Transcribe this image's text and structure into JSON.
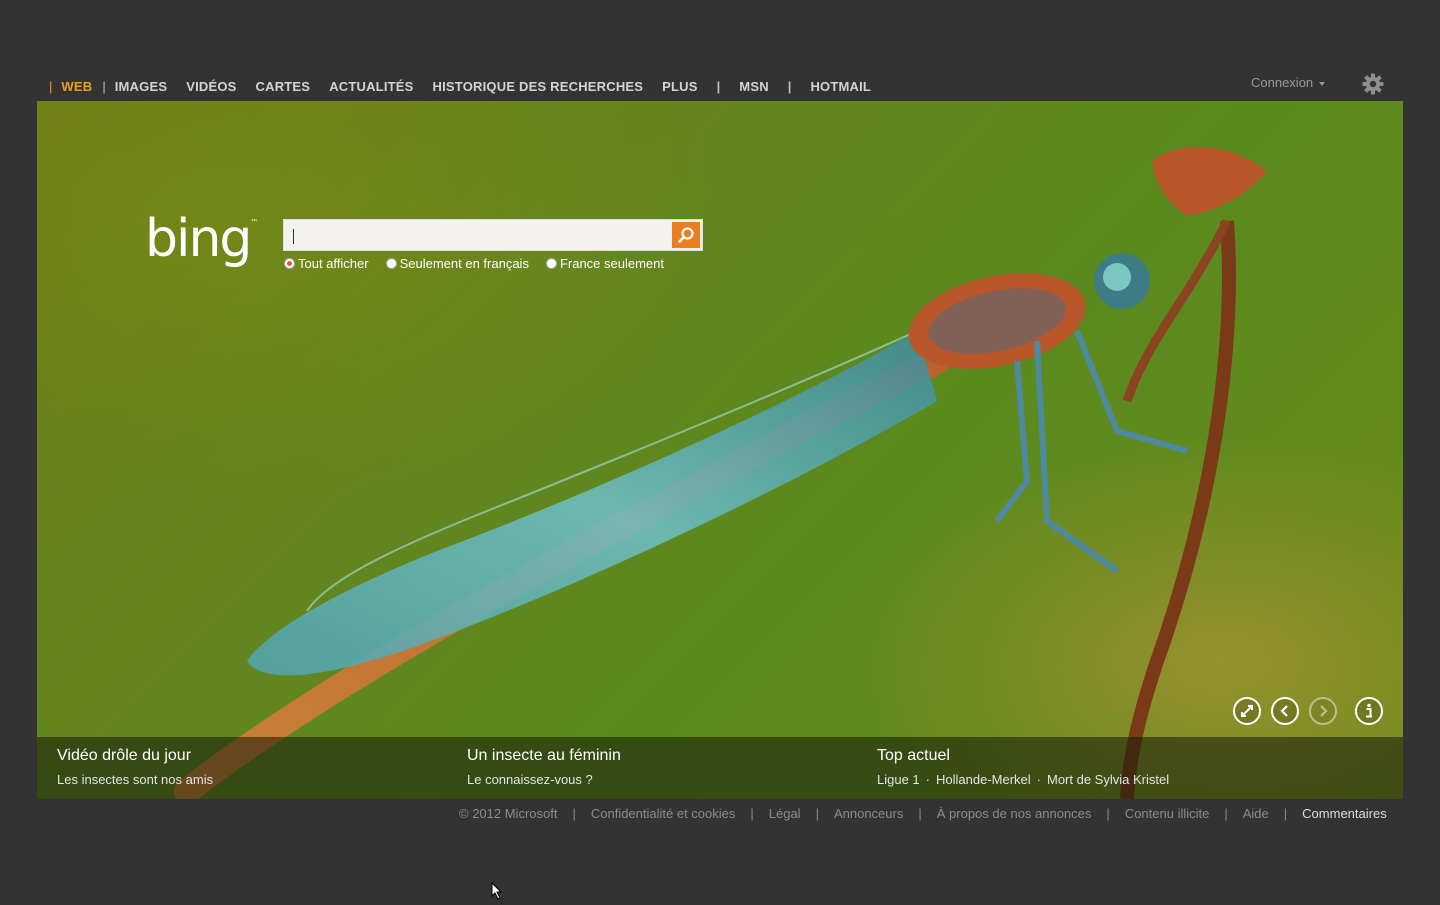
{
  "nav": {
    "items": [
      "WEB",
      "IMAGES",
      "VIDÉOS",
      "CARTES",
      "ACTUALITÉS",
      "HISTORIQUE DES RECHERCHES",
      "PLUS"
    ],
    "extra": [
      "MSN",
      "HOTMAIL"
    ],
    "active": "WEB",
    "active_color": "#f39c12"
  },
  "connexion": "Connexion",
  "logo": {
    "text": "bing",
    "tm": "™"
  },
  "search": {
    "value": "",
    "button_icon": "search-icon",
    "button_color": "#ea7f20",
    "options": [
      "Tout afficher",
      "Seulement en français",
      "France seulement"
    ],
    "selected": "Tout afficher"
  },
  "hero_controls": [
    "expand-icon",
    "previous-icon",
    "next-icon",
    "info-icon"
  ],
  "strip": {
    "col1": {
      "title": "Vidéo drôle du jour",
      "sub": "Les insectes sont nos amis"
    },
    "col2": {
      "title": "Un insecte au féminin",
      "sub": "Le connaissez-vous ?"
    },
    "col3": {
      "title": "Top actuel",
      "links": [
        "Ligue 1",
        "Hollande-Merkel",
        "Mort de Sylvia Kristel"
      ]
    }
  },
  "footer": {
    "copyright": "© 2012 Microsoft",
    "links": [
      "Confidentialité et cookies",
      "Légal",
      "Annonceurs",
      "À propos de nos annonces",
      "Contenu illicite",
      "Aide",
      "Commentaires"
    ]
  }
}
